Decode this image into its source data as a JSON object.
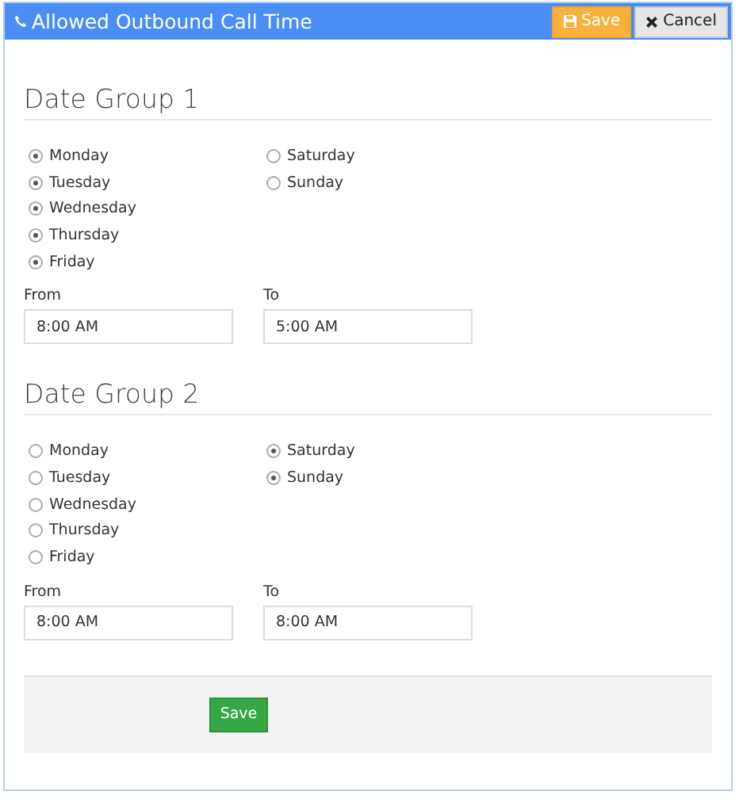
{
  "window": {
    "title": "Allowed Outbound Call Time"
  },
  "header_buttons": [
    {
      "label": "Save",
      "kind": "save"
    },
    {
      "label": "Cancel",
      "kind": "cancel"
    }
  ],
  "date_groups": [
    {
      "title": "Date Group 1",
      "days": [
        {
          "label": "Monday",
          "checked": true
        },
        {
          "label": "Tuesday",
          "checked": true
        },
        {
          "label": "Wednesday",
          "checked": true
        },
        {
          "label": "Thursday",
          "checked": true
        },
        {
          "label": "Friday",
          "checked": true
        },
        {
          "label": "Saturday",
          "checked": false
        },
        {
          "label": "Sunday",
          "checked": false
        }
      ],
      "from": {
        "label": "From",
        "value": "8:00 AM"
      },
      "to": {
        "label": "To",
        "value": "5:00 AM"
      }
    },
    {
      "title": "Date Group 2",
      "days": [
        {
          "label": "Monday",
          "checked": false
        },
        {
          "label": "Tuesday",
          "checked": false
        },
        {
          "label": "Wednesday",
          "checked": false
        },
        {
          "label": "Thursday",
          "checked": false
        },
        {
          "label": "Friday",
          "checked": false
        },
        {
          "label": "Saturday",
          "checked": true
        },
        {
          "label": "Sunday",
          "checked": true
        }
      ],
      "from": {
        "label": "From",
        "value": "8:00 AM"
      },
      "to": {
        "label": "To",
        "value": "8:00 AM"
      }
    }
  ],
  "footer_button": {
    "label": "Save"
  }
}
